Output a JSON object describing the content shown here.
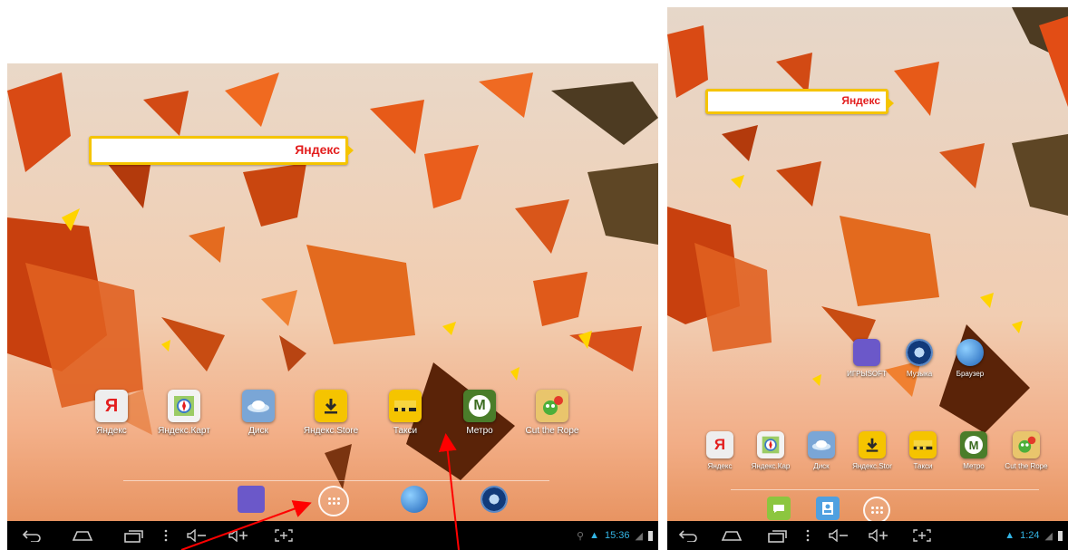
{
  "left_screen": {
    "search_brand": "Яндекс",
    "apps": [
      {
        "label": "Яндекс",
        "icon": "yandex-icon",
        "color": "#e8e8e8"
      },
      {
        "label": "Яндекс.Карт",
        "icon": "yandex-maps-icon",
        "color": "#f3f3f3"
      },
      {
        "label": "Диск",
        "icon": "disk-icon",
        "color": "#7aa6d6"
      },
      {
        "label": "Яндекс.Store",
        "icon": "store-icon",
        "color": "#f5c400"
      },
      {
        "label": "Такси",
        "icon": "taxi-icon",
        "color": "#f5c400"
      },
      {
        "label": "Метро",
        "icon": "metro-icon",
        "color": "#4a7d2a"
      },
      {
        "label": "Cut the Rope",
        "icon": "cut-the-rope-icon",
        "color": "#e9c56c"
      }
    ],
    "status": {
      "time": "15:36"
    }
  },
  "right_screen": {
    "search_brand": "Яндекс",
    "folder_apps": [
      {
        "label": "ИГРЫSOFT",
        "icon": "games-folder-icon",
        "color": "#6b58c9"
      },
      {
        "label": "Музыка",
        "icon": "music-icon",
        "color": "#1c5fa8"
      },
      {
        "label": "Браузер",
        "icon": "browser-icon",
        "color": "#2f7bd2"
      }
    ],
    "apps": [
      {
        "label": "Яндекс",
        "icon": "yandex-icon",
        "color": "#e8e8e8"
      },
      {
        "label": "Яндекс.Кар",
        "icon": "yandex-maps-icon",
        "color": "#f3f3f3"
      },
      {
        "label": "Диск",
        "icon": "disk-icon",
        "color": "#7aa6d6"
      },
      {
        "label": "Яндекс.Stor",
        "icon": "store-icon",
        "color": "#f5c400"
      },
      {
        "label": "Такси",
        "icon": "taxi-icon",
        "color": "#f5c400"
      },
      {
        "label": "Метро",
        "icon": "metro-icon",
        "color": "#4a7d2a"
      },
      {
        "label": "Cut the Rope",
        "icon": "cut-the-rope-icon",
        "color": "#e9c56c"
      }
    ],
    "status": {
      "time": "1:24"
    }
  },
  "colors": {
    "accent": "#33b5e5",
    "yandex_yellow": "#f5c400",
    "yandex_red": "#e31e1e",
    "arrow": "#ff0000"
  }
}
